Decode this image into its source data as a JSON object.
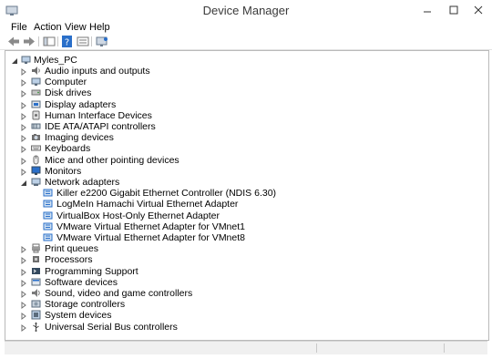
{
  "window": {
    "title": "Device Manager"
  },
  "menu": {
    "file": "File",
    "action": "Action",
    "view": "View",
    "help": "Help"
  },
  "tree": {
    "root": "Myles_PC",
    "categories": [
      {
        "label": "Audio inputs and outputs",
        "icon": "speaker-icon",
        "expanded": false
      },
      {
        "label": "Computer",
        "icon": "computer-icon",
        "expanded": false
      },
      {
        "label": "Disk drives",
        "icon": "disk-drive-icon",
        "expanded": false
      },
      {
        "label": "Display adapters",
        "icon": "display-adapter-icon",
        "expanded": false
      },
      {
        "label": "Human Interface Devices",
        "icon": "hid-icon",
        "expanded": false
      },
      {
        "label": "IDE ATA/ATAPI controllers",
        "icon": "ide-controller-icon",
        "expanded": false
      },
      {
        "label": "Imaging devices",
        "icon": "camera-icon",
        "expanded": false
      },
      {
        "label": "Keyboards",
        "icon": "keyboard-icon",
        "expanded": false
      },
      {
        "label": "Mice and other pointing devices",
        "icon": "mouse-icon",
        "expanded": false
      },
      {
        "label": "Monitors",
        "icon": "monitor-icon",
        "expanded": false
      },
      {
        "label": "Network adapters",
        "icon": "network-adapter-icon",
        "expanded": true,
        "children": [
          "Killer e2200 Gigabit Ethernet Controller (NDIS 6.30)",
          "LogMeIn Hamachi Virtual Ethernet Adapter",
          "VirtualBox Host-Only Ethernet Adapter",
          "VMware Virtual Ethernet Adapter for VMnet1",
          "VMware Virtual Ethernet Adapter for VMnet8"
        ]
      },
      {
        "label": "Print queues",
        "icon": "printer-icon",
        "expanded": false
      },
      {
        "label": "Processors",
        "icon": "processor-icon",
        "expanded": false
      },
      {
        "label": "Programming Support",
        "icon": "programming-icon",
        "expanded": false
      },
      {
        "label": "Software devices",
        "icon": "software-device-icon",
        "expanded": false
      },
      {
        "label": "Sound, video and game controllers",
        "icon": "sound-icon",
        "expanded": false
      },
      {
        "label": "Storage controllers",
        "icon": "storage-icon",
        "expanded": false
      },
      {
        "label": "System devices",
        "icon": "system-icon",
        "expanded": false
      },
      {
        "label": "Universal Serial Bus controllers",
        "icon": "usb-icon",
        "expanded": false
      }
    ]
  },
  "colors": {
    "accent_blue": "#2a6fc9",
    "icon_gray": "#6e6e6e"
  }
}
